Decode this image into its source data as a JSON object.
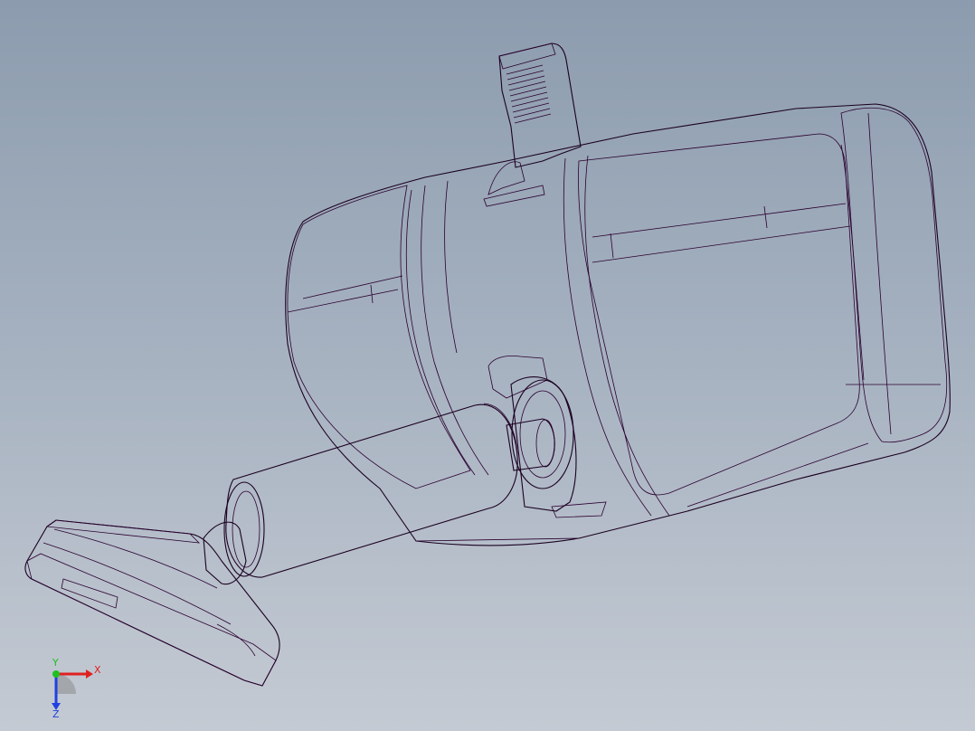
{
  "viewport": {
    "background_top": "#8c9cae",
    "background_bottom": "#c4cad3"
  },
  "model": {
    "name": "",
    "face_color": "#e600e6",
    "shade_color": "#b800b8",
    "highlight_color": "#ff5cff",
    "edge_color": "#1a0020"
  },
  "triad": {
    "x_label": "X",
    "y_label": "Y",
    "z_label": "Z",
    "x_color": "#e02020",
    "y_color": "#20c020",
    "z_color": "#2040e0"
  }
}
